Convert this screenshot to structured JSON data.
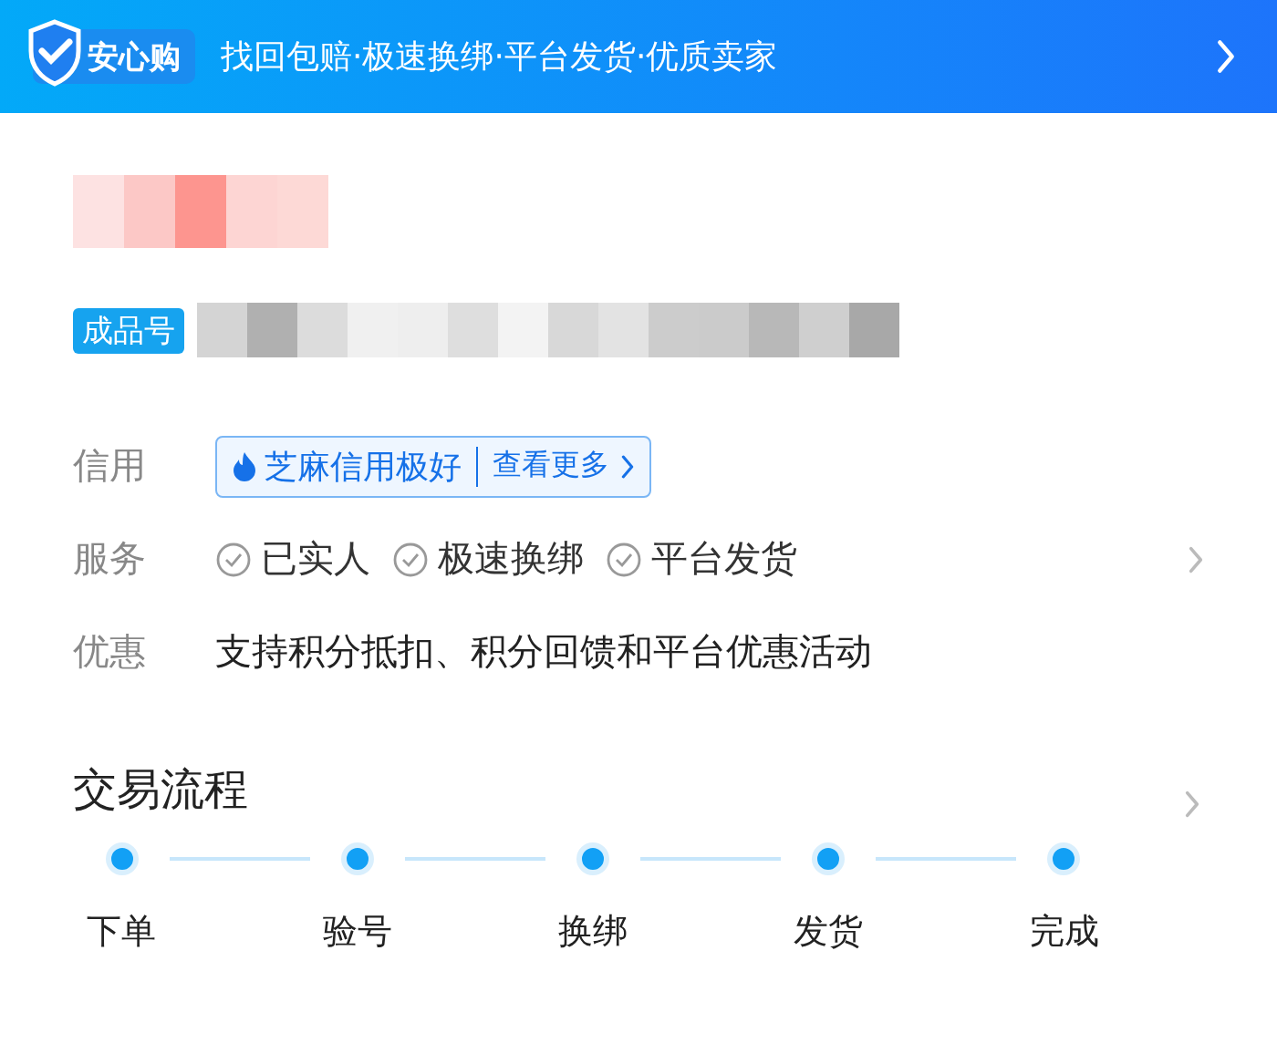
{
  "banner": {
    "badge": "安心购",
    "slogan": "找回包赔·极速换绑·平台发货·优质卖家"
  },
  "product": {
    "tag": "成品号"
  },
  "details": [
    {
      "kind": "credit",
      "label": "信用",
      "credit_text": "芝麻信用极好",
      "more": "查看更多"
    },
    {
      "kind": "services",
      "label": "服务",
      "items": [
        "已实人",
        "极速换绑",
        "平台发货"
      ]
    },
    {
      "kind": "text",
      "label": "优惠",
      "text": "支持积分抵扣、积分回馈和平台优惠活动"
    }
  ],
  "process": {
    "title": "交易流程",
    "steps": [
      "下单",
      "验号",
      "换绑",
      "发货",
      "完成"
    ]
  }
}
